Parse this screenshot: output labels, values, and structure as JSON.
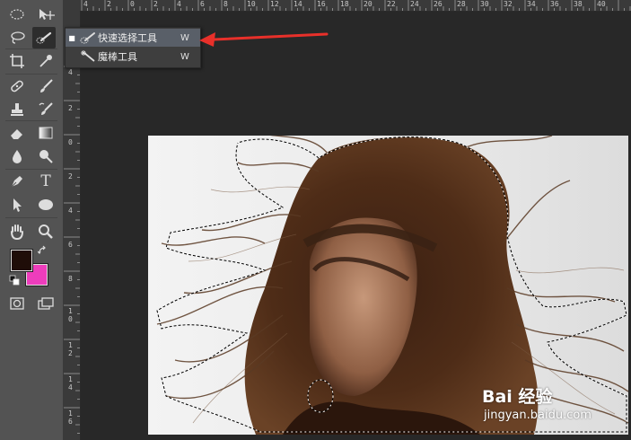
{
  "toolbox": {
    "tools": [
      {
        "name": "elliptical-marquee-tool",
        "icon": "ellipse-marquee-icon",
        "selected": false
      },
      {
        "name": "move-tool",
        "icon": "move-icon",
        "selected": false
      },
      {
        "name": "lasso-tool",
        "icon": "lasso-icon",
        "selected": false
      },
      {
        "name": "quick-selection-tool",
        "icon": "quick-selection-brush-icon",
        "selected": true
      },
      {
        "name": "crop-tool",
        "icon": "crop-icon",
        "selected": false
      },
      {
        "name": "eyedropper-tool",
        "icon": "eyedropper-icon",
        "selected": false
      },
      {
        "name": "healing-brush-tool",
        "icon": "bandage-icon",
        "selected": false
      },
      {
        "name": "brush-tool",
        "icon": "brush-icon",
        "selected": false
      },
      {
        "name": "clone-stamp-tool",
        "icon": "stamp-icon",
        "selected": false
      },
      {
        "name": "history-brush-tool",
        "icon": "history-brush-icon",
        "selected": false
      },
      {
        "name": "eraser-tool",
        "icon": "eraser-icon",
        "selected": false
      },
      {
        "name": "gradient-tool",
        "icon": "gradient-icon",
        "selected": false
      },
      {
        "name": "blur-tool",
        "icon": "droplet-icon",
        "selected": false
      },
      {
        "name": "dodge-tool",
        "icon": "dodge-icon",
        "selected": false
      },
      {
        "name": "pen-tool",
        "icon": "pen-icon",
        "selected": false
      },
      {
        "name": "type-tool",
        "icon": "type-icon",
        "label": "T",
        "selected": false
      },
      {
        "name": "path-selection-tool",
        "icon": "arrow-pointer-icon",
        "selected": false
      },
      {
        "name": "ellipse-tool",
        "icon": "ellipse-shape-icon",
        "selected": false
      },
      {
        "name": "hand-tool",
        "icon": "hand-icon",
        "selected": false
      },
      {
        "name": "zoom-tool",
        "icon": "magnifier-icon",
        "selected": false
      }
    ],
    "foreground_color": "#1f0d08",
    "background_color": "#ee3dbc"
  },
  "flyout": {
    "items": [
      {
        "label": "快速选择工具",
        "shortcut": "W",
        "icon": "quick-selection-brush-icon",
        "active": true
      },
      {
        "label": "魔棒工具",
        "shortcut": "W",
        "icon": "magic-wand-icon",
        "active": false
      }
    ]
  },
  "rulers": {
    "horizontal": [
      "4",
      "2",
      "0",
      "2",
      "4",
      "6",
      "8",
      "10",
      "12",
      "14",
      "16",
      "18",
      "20",
      "22",
      "24",
      "26",
      "28",
      "30",
      "32",
      "34",
      "36",
      "38",
      "40"
    ],
    "vertical": [
      "4",
      "2",
      "0",
      "2",
      "4",
      "6",
      "8",
      "10",
      "12",
      "14",
      "16"
    ]
  },
  "accent_color": "#e8302a",
  "watermark": {
    "logo": "Bai 经验",
    "url": "jingyan.baidu.com"
  }
}
